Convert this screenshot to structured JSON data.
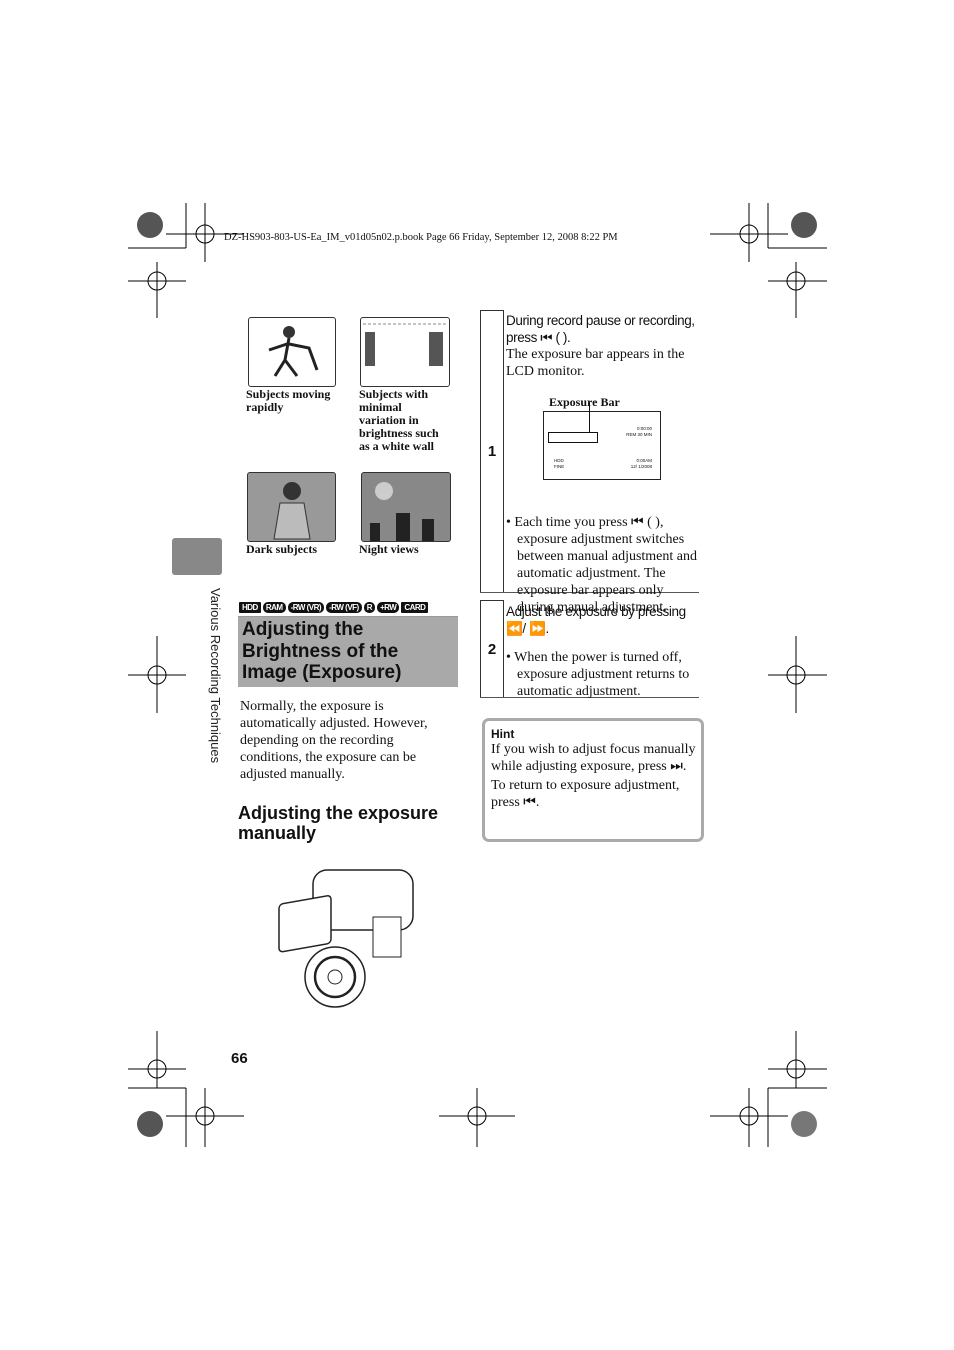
{
  "header": "DZ-HS903-803-US-Ea_IM_v01d05n02.p.book  Page 66  Friday, September 12, 2008  8:22 PM",
  "images": [
    {
      "caption": "Subjects moving rapidly"
    },
    {
      "caption": "Subjects with minimal variation in brightness such as a white wall"
    },
    {
      "caption": "Dark subjects"
    },
    {
      "caption": "Night views"
    }
  ],
  "side_tab": "Various Recording Techniques",
  "badges": [
    "HDD",
    "RAM",
    "-RW (VR)",
    "-RW (VF)",
    "R",
    "+RW",
    "CARD"
  ],
  "title": "Adjusting the Brightness of the Image (Exposure)",
  "intro": "Normally, the exposure is automatically adjusted. However, depending on the recording conditions, the exposure can be adjusted manually.",
  "subheading": "Adjusting the exposure manually",
  "page_number": "66",
  "steps": [
    {
      "num": "1",
      "instruction": "During record pause or recording, press ⏮ ( ).",
      "result": "The exposure bar appears in the LCD monitor.",
      "figure_label": "Exposure Bar",
      "lcd": {
        "time": "0:00:00",
        "remain": "REM 30 MIN",
        "clock": "0:00AM",
        "date": "12/ 1/2008",
        "media": "HDD",
        "quality": "FINE"
      },
      "bullet": "Each time you press ⏮ ( ), exposure adjustment switches between manual adjustment and automatic adjustment. The exposure bar appears only during manual adjustment."
    },
    {
      "num": "2",
      "instruction": "Adjust the exposure by pressing ⏪/ ⏩.",
      "bullet": "When the power is turned off, exposure adjustment returns to automatic adjustment."
    }
  ],
  "hint": {
    "title": "Hint",
    "p1": "If you wish to adjust focus manually while adjusting exposure, press ⏭.",
    "p2": "To return to exposure adjustment, press ⏮."
  }
}
